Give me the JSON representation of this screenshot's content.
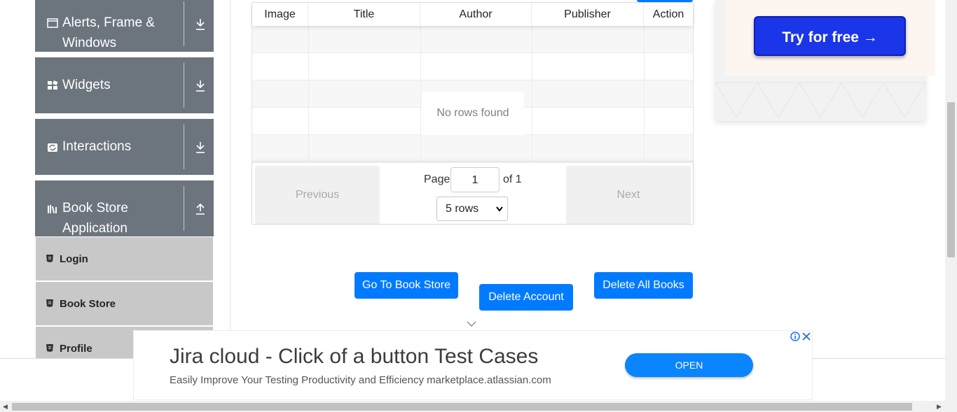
{
  "sidebar": {
    "groups": [
      {
        "label": "Alerts, Frame & Windows",
        "icon": "window-icon",
        "state": "collapsed"
      },
      {
        "label": "Widgets",
        "icon": "widgets-icon",
        "state": "collapsed"
      },
      {
        "label": "Interactions",
        "icon": "interactions-icon",
        "state": "collapsed"
      },
      {
        "label": "Book Store Application",
        "icon": "books-icon",
        "state": "expanded"
      }
    ],
    "items": [
      {
        "label": "Login",
        "icon": "html5-icon"
      },
      {
        "label": "Book Store",
        "icon": "html5-icon"
      },
      {
        "label": "Profile",
        "icon": "html5-icon"
      }
    ]
  },
  "table": {
    "headers": [
      "Image",
      "Title",
      "Author",
      "Publisher",
      "Action"
    ],
    "empty_text": "No rows found",
    "pagination": {
      "previous": "Previous",
      "next": "Next",
      "page_label": "Page",
      "page_value": "1",
      "of_label": "of 1",
      "rows_select": "5 rows"
    }
  },
  "actions": {
    "go_to_store": "Go To Book Store",
    "delete_account": "Delete Account",
    "delete_all": "Delete All Books"
  },
  "right_ad": {
    "cta": "Try for free →"
  },
  "bottom_ad": {
    "title": "Jira cloud - Click of a button Test Cases",
    "subtitle": "Easily Improve Your Testing Productivity and Efficiency marketplace.atlassian.com",
    "open": "OPEN"
  },
  "colors": {
    "primary": "#007bff",
    "sidebar": "#6c757d",
    "menu_item": "#c8c8c8",
    "ad_button": "#1b35e8"
  }
}
